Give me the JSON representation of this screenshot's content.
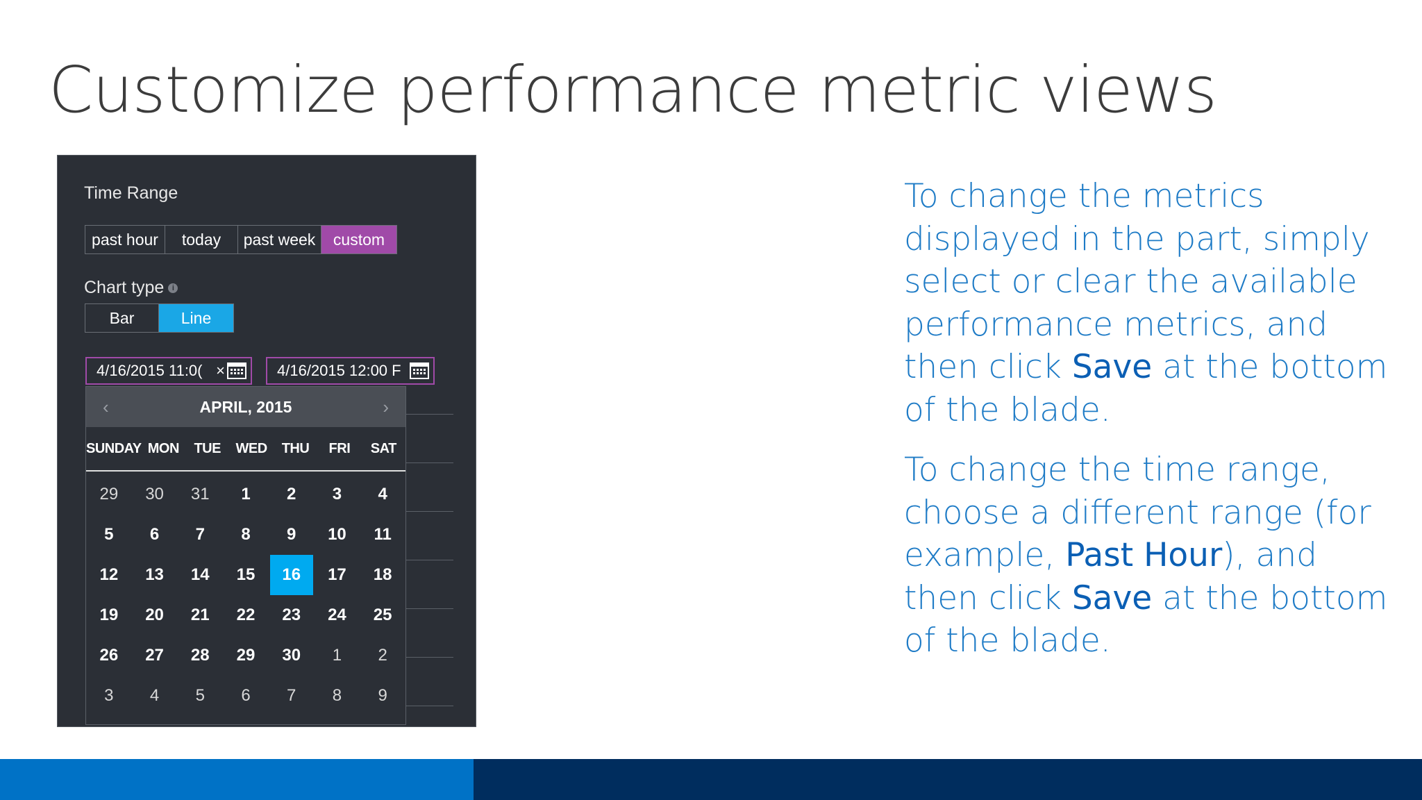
{
  "slide": {
    "title": "Customize performance metric views"
  },
  "panel": {
    "time_range_label": "Time Range",
    "time_range_options": [
      {
        "label": "past hour",
        "selected": false
      },
      {
        "label": "today",
        "selected": false
      },
      {
        "label": "past week",
        "selected": false
      },
      {
        "label": "custom",
        "selected": true
      }
    ],
    "chart_type_label": "Chart type",
    "chart_type_options": [
      {
        "label": "Bar",
        "selected": false
      },
      {
        "label": "Line",
        "selected": true
      }
    ],
    "start_date_value": "4/16/2015 11:0(",
    "start_clear_glyph": "×",
    "end_date_value": "4/16/2015 12:00 F",
    "calendar": {
      "prev_glyph": "‹",
      "next_glyph": "›",
      "month_label": "APRIL, 2015",
      "day_names": [
        "SUNDAY",
        "MON",
        "TUE",
        "WED",
        "THU",
        "FRI",
        "SAT"
      ],
      "weeks": [
        [
          "29",
          "30",
          "31",
          "1",
          "2",
          "3",
          "4"
        ],
        [
          "5",
          "6",
          "7",
          "8",
          "9",
          "10",
          "11"
        ],
        [
          "12",
          "13",
          "14",
          "15",
          "16",
          "17",
          "18"
        ],
        [
          "19",
          "20",
          "21",
          "22",
          "23",
          "24",
          "25"
        ],
        [
          "26",
          "27",
          "28",
          "29",
          "30",
          "1",
          "2"
        ],
        [
          "3",
          "4",
          "5",
          "6",
          "7",
          "8",
          "9"
        ]
      ],
      "selected_day": "16"
    }
  },
  "instructions": {
    "p1_a": "To change the metrics displayed in the part, simply select or clear the available performance metrics, and then click ",
    "p1_em": "Save",
    "p1_b": " at the bottom of the blade.",
    "p2_a": "To change the time range, choose a different range (for example, ",
    "p2_em1": "Past Hour",
    "p2_b": "), and then click ",
    "p2_em2": "Save",
    "p2_c": " at the bottom of the blade."
  },
  "colors": {
    "accent_purple": "#a04aa8",
    "accent_cyan": "#1aa7e6",
    "footer_left": "#0072c6",
    "footer_right": "#002d5e"
  }
}
